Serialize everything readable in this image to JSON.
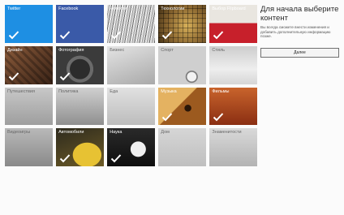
{
  "sidebar": {
    "title": "Для начала выберите контент",
    "description": "Вы всегда сможете внести изменения и добавить дополнительную информацию позже.",
    "done_label": "Далее"
  },
  "tiles": [
    {
      "label": "Twitter",
      "selected": true,
      "style": "twitter",
      "label_color": "#ffffff"
    },
    {
      "label": "Facebook",
      "selected": true,
      "style": "facebook",
      "label_color": "#ffffff"
    },
    {
      "label": "Новости",
      "selected": true,
      "style": "news",
      "label_color": "#ffffff"
    },
    {
      "label": "Технологии",
      "selected": true,
      "style": "tech",
      "label_color": "#ffffff"
    },
    {
      "label": "Выбор Flipboard",
      "selected": true,
      "style": "flipboard",
      "label_color": "#ffffff"
    },
    {
      "label": "Дизайн",
      "selected": true,
      "style": "design",
      "label_color": "#ffffff"
    },
    {
      "label": "Фотография",
      "selected": true,
      "style": "photo",
      "label_color": "#ffffff"
    },
    {
      "label": "Бизнес",
      "selected": false,
      "style": "business",
      "label_color": "#666666"
    },
    {
      "label": "Спорт",
      "selected": false,
      "style": "sport",
      "label_color": "#666666"
    },
    {
      "label": "Стиль",
      "selected": false,
      "style": "style",
      "label_color": "#666666"
    },
    {
      "label": "Путешествия",
      "selected": false,
      "style": "travel",
      "label_color": "#666666"
    },
    {
      "label": "Политика",
      "selected": false,
      "style": "politics",
      "label_color": "#666666"
    },
    {
      "label": "Еда",
      "selected": false,
      "style": "food",
      "label_color": "#666666"
    },
    {
      "label": "Музыка",
      "selected": true,
      "style": "music",
      "label_color": "#ffffff"
    },
    {
      "label": "Фильмы",
      "selected": true,
      "style": "films",
      "label_color": "#ffffff"
    },
    {
      "label": "Видеоигры",
      "selected": false,
      "style": "videogames",
      "label_color": "#666666"
    },
    {
      "label": "Автомобили",
      "selected": true,
      "style": "cars",
      "label_color": "#ffffff"
    },
    {
      "label": "Наука",
      "selected": true,
      "style": "science",
      "label_color": "#ffffff"
    },
    {
      "label": "Дом",
      "selected": false,
      "style": "home",
      "label_color": "#666666"
    },
    {
      "label": "Знаменитости",
      "selected": false,
      "style": "celebs",
      "label_color": "#666666"
    }
  ],
  "icons": {
    "selected_tile": "checkmark-icon"
  }
}
